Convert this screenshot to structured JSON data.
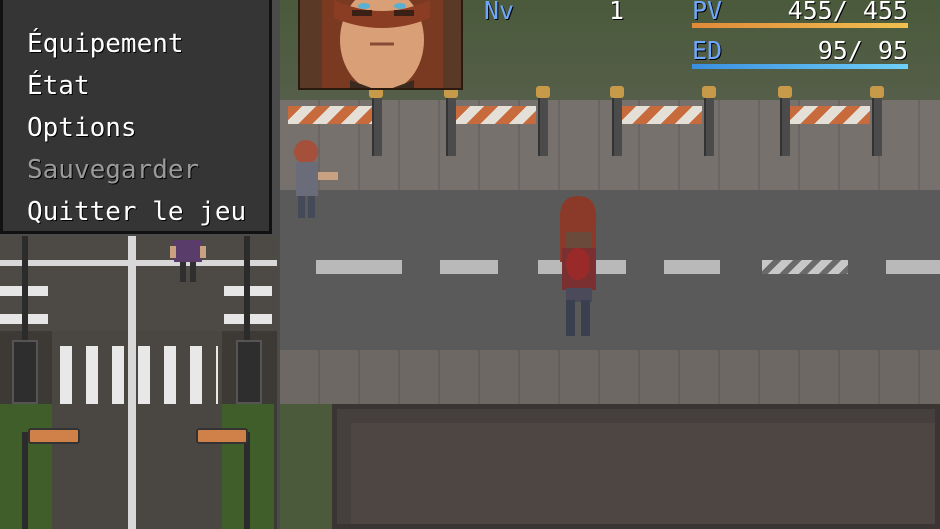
{
  "menu": {
    "items": [
      {
        "label": "Équipement",
        "enabled": true
      },
      {
        "label": "État",
        "enabled": true
      },
      {
        "label": "Options",
        "enabled": true
      },
      {
        "label": "Sauvegarder",
        "enabled": false
      },
      {
        "label": "Quitter le jeu",
        "enabled": true
      }
    ]
  },
  "status": {
    "level_label": "Nv",
    "level_value": "1",
    "hp_label": "PV",
    "hp_value": "455/ 455",
    "hp_fraction": 1.0,
    "mp_label": "ED",
    "mp_value": "95/  95",
    "mp_fraction": 1.0
  },
  "colors": {
    "system_blue": "#6fa7ff",
    "hp_gauge": [
      "#e08a3a",
      "#f0c050"
    ],
    "mp_gauge": [
      "#3a8fe0",
      "#6fd0f8"
    ]
  },
  "icons": {
    "portrait": "character-face-icon",
    "player": "player-sprite-icon"
  }
}
